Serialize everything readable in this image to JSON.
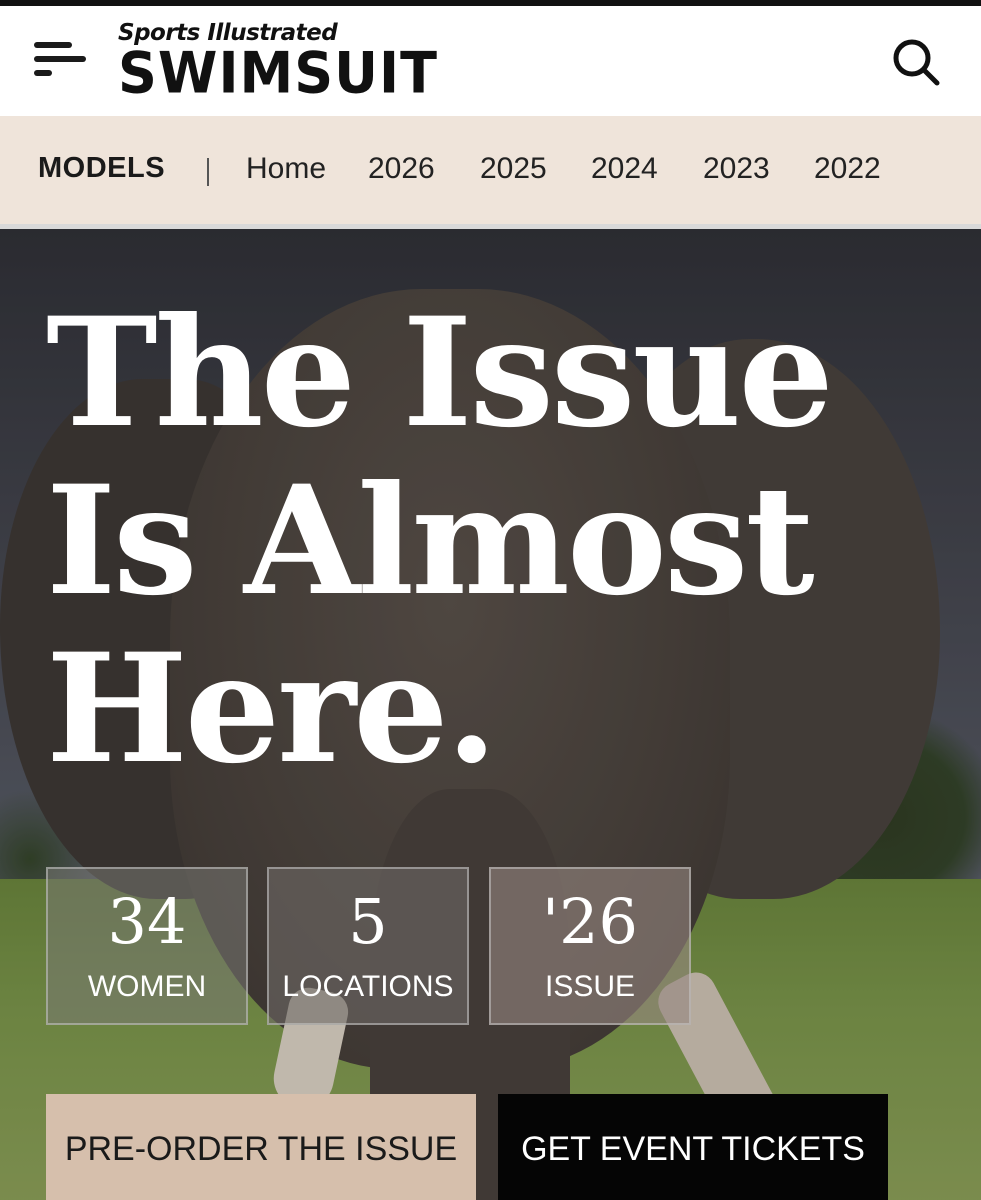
{
  "header": {
    "logo_top": "Sports Illustrated",
    "logo_bottom": "SWIMSUIT",
    "menu_icon": "hamburger-menu-icon",
    "search_icon": "search-icon"
  },
  "nav": {
    "section": "MODELS",
    "links": [
      "Home",
      "2026",
      "2025",
      "2024",
      "2023",
      "2022"
    ]
  },
  "hero": {
    "headline_lines": [
      "The Issue",
      "Is Almost",
      "Here."
    ],
    "stats": [
      {
        "value": "34",
        "label": "WOMEN"
      },
      {
        "value": "5",
        "label": "LOCATIONS"
      },
      {
        "value": "'26",
        "label": "ISSUE"
      }
    ],
    "buttons": {
      "preorder": "PRE-ORDER THE ISSUE",
      "tickets": "GET EVENT TICKETS"
    }
  },
  "colors": {
    "nav_bg": "#efe4da",
    "preorder_bg": "#d6bfac",
    "tickets_bg": "#050505"
  }
}
